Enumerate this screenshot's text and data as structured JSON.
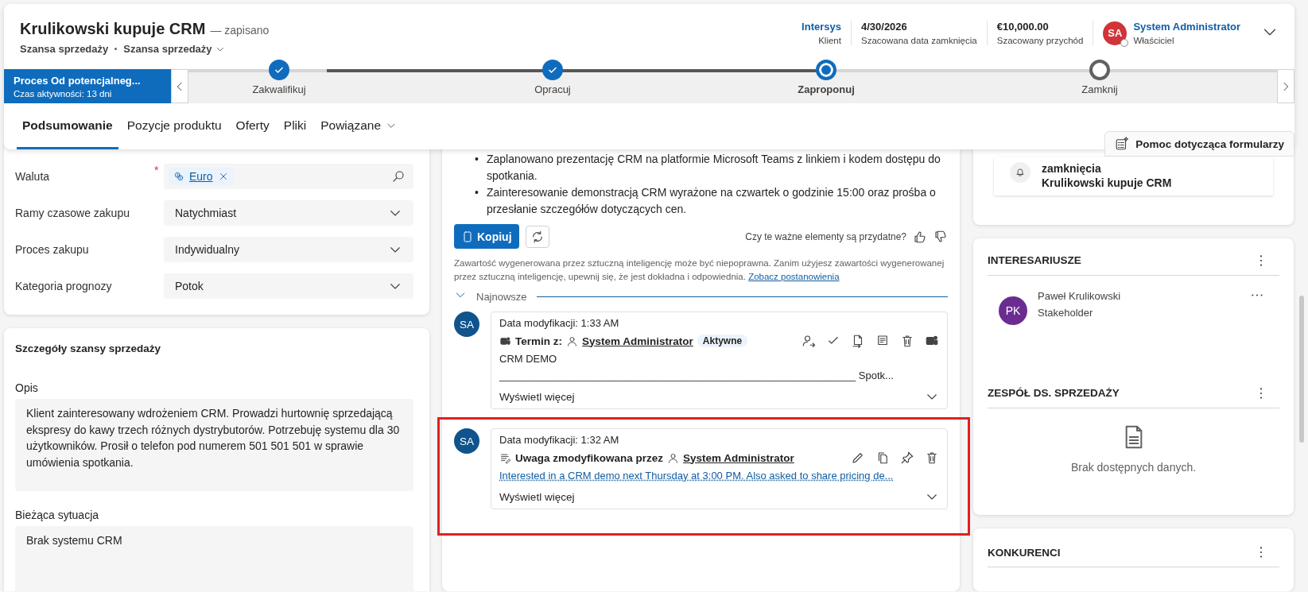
{
  "record": {
    "title": "Krulikowski kupuje CRM",
    "status": "— zapisano",
    "entity": "Szansa sprzedaży",
    "form": "Szansa sprzedaży"
  },
  "summary": [
    {
      "value": "Intersys",
      "label": "Klient",
      "kind": "link"
    },
    {
      "value": "4/30/2026",
      "label": "Szacowana data zamknięcia",
      "kind": "text"
    },
    {
      "value": "€10,000.00",
      "label": "Szacowany przychód",
      "kind": "text"
    }
  ],
  "owner": {
    "initials": "SA",
    "name": "System Administrator",
    "label": "Właściciel"
  },
  "process": {
    "name": "Proces Od potencjalneg...",
    "duration": "Czas aktywności: 13 dni",
    "stages": [
      {
        "label": "Zakwalifikuj",
        "kind": "done"
      },
      {
        "label": "Opracuj",
        "kind": "done"
      },
      {
        "label": "Zaproponuj",
        "kind": "active"
      },
      {
        "label": "Zamknij",
        "kind": "pending"
      }
    ]
  },
  "tabs": [
    {
      "label": "Podsumowanie",
      "selected": true,
      "has_menu": false
    },
    {
      "label": "Pozycje produktu",
      "selected": false,
      "has_menu": false
    },
    {
      "label": "Oferty",
      "selected": false,
      "has_menu": false
    },
    {
      "label": "Pliki",
      "selected": false,
      "has_menu": false
    },
    {
      "label": "Powiązane",
      "selected": false,
      "has_menu": true
    }
  ],
  "help_button": "Pomoc dotycząca formularzy",
  "form": {
    "required_mark": "*",
    "fields": [
      {
        "label": "Waluta",
        "kind": "lookup",
        "value": "Euro",
        "required": true
      },
      {
        "label": "Ramy czasowe zakupu",
        "kind": "select",
        "value": "Natychmiast",
        "required": false
      },
      {
        "label": "Proces zakupu",
        "kind": "select",
        "value": "Indywidualny",
        "required": false
      },
      {
        "label": "Kategoria prognozy",
        "kind": "select",
        "value": "Potok",
        "required": false
      }
    ]
  },
  "details": {
    "title": "Szczegóły szansy sprzedaży",
    "fields": [
      {
        "label": "Opis",
        "value": "Klient zainteresowany wdrożeniem CRM. Prowadzi hurtownię sprzedającą ekspresy do kawy trzech różnych dystrybutorów. Potrzebuję systemu dla 30 użytkowników. Prosił o telefon pod numerem 501 501 501 w sprawie umówienia spotkania."
      },
      {
        "label": "Bieżąca sytuacja",
        "value": "Brak systemu CRM"
      }
    ]
  },
  "ai_summary": {
    "bullets": [
      "Zaplanowano prezentację CRM na platformie Microsoft Teams z linkiem i kodem dostępu do spotkania.",
      "Zainteresowanie demonstracją CRM wyrażone na czwartek o godzinie 15:00 oraz prośba o przesłanie szczegółów dotyczących cen."
    ],
    "bullet": "•",
    "copy_button": "Kopiuj",
    "feedback_question": "Czy te ważne elementy są przydatne?",
    "disclaimer": "Zawartość wygenerowana przez sztuczną inteligencję może być niepoprawna. Zanim użyjesz zawartości wygenerowanej przez sztuczną inteligencję, upewnij się, że jest dokładna i odpowiednia.",
    "disclaimer_link": "Zobacz postanowienia"
  },
  "timeline": {
    "group": "Najnowsze",
    "expanded": true,
    "entries": [
      {
        "kind": "appointment",
        "initials": "SA",
        "modified": "Data modyfikacji: 1:33 AM",
        "type_label": "Termin z:",
        "author": "System Administrator",
        "badge": "Aktywne",
        "lines": [
          "CRM DEMO",
          "______________________________________________________________ Spotk..."
        ],
        "show_more": "Wyświetl więcej",
        "highlighted": false
      },
      {
        "kind": "note",
        "initials": "SA",
        "modified": "Data modyfikacji: 1:32 AM",
        "type_label": "Uwaga zmodyfikowana przez",
        "author": "System Administrator",
        "link_text": "Interested in a CRM demo next Thursday at 3:00 PM. Also asked to share pricing de...",
        "show_more": "Wyświetl więcej",
        "highlighted": true
      }
    ]
  },
  "closing_card": {
    "lines": [
      "zamknięcia",
      "Krulikowski kupuje CRM"
    ]
  },
  "stakeholders": {
    "title": "INTERESARIUSZE",
    "people": [
      {
        "initials": "PK",
        "name": "Paweł Krulikowski",
        "role": "Stakeholder"
      }
    ]
  },
  "sales_team": {
    "title": "ZESPÓŁ DS. SPRZEDAŻY",
    "empty_text": "Brak dostępnych danych."
  },
  "competitors": {
    "title": "KONKURENCI"
  }
}
